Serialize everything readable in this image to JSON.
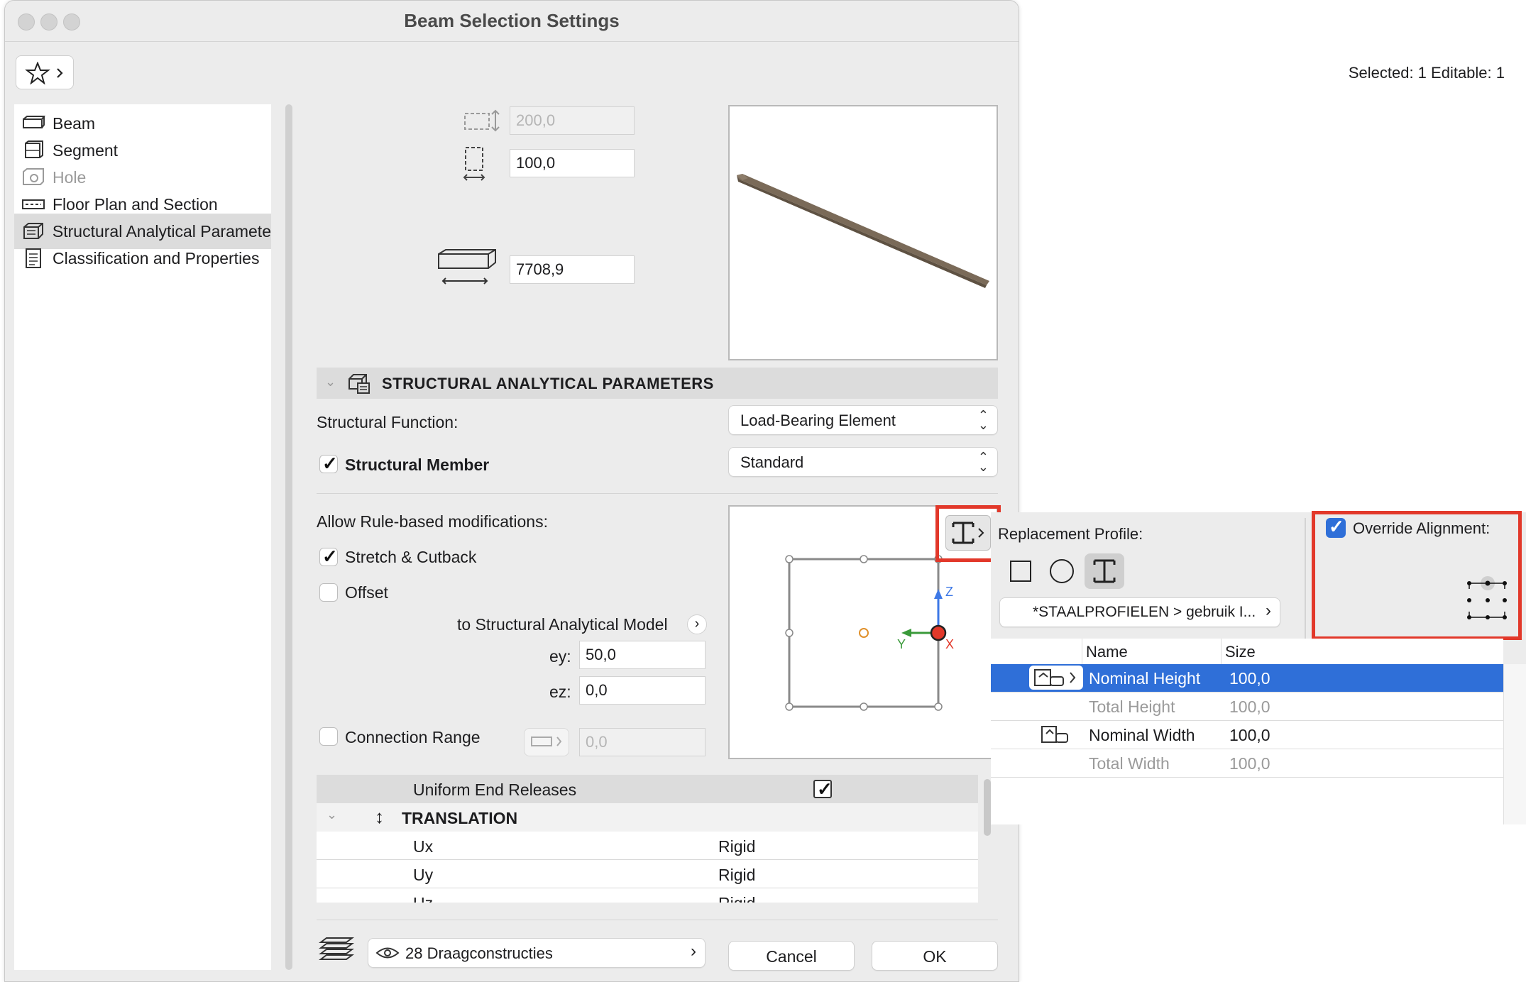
{
  "window": {
    "title": "Beam Selection Settings"
  },
  "header": {
    "selected_info": "Selected: 1 Editable: 1"
  },
  "sidebar": {
    "items": [
      {
        "label": "Beam",
        "icon": "beam-icon"
      },
      {
        "label": "Segment",
        "icon": "segment-icon"
      },
      {
        "label": "Hole",
        "icon": "hole-icon"
      },
      {
        "label": "Floor Plan and Section",
        "icon": "floor-plan-icon"
      },
      {
        "label": "Structural Analytical Paramete",
        "icon": "structural-analytical-icon"
      },
      {
        "label": "Classification and Properties",
        "icon": "classification-icon"
      }
    ],
    "selected_index": 4
  },
  "geometry": {
    "height_value": "200,0",
    "width_value": "100,0",
    "length_value": "7708,9"
  },
  "section": {
    "title": "STRUCTURAL ANALYTICAL PARAMETERS"
  },
  "structural": {
    "function_label": "Structural Function:",
    "function_value": "Load-Bearing Element",
    "member_label": "Structural Member",
    "member_checked": true,
    "member_value": "Standard",
    "rule_label": "Allow Rule-based modifications:",
    "stretch_label": "Stretch & Cutback",
    "stretch_checked": true,
    "offset_label": "Offset",
    "offset_checked": false,
    "to_model_label": "to Structural Analytical Model",
    "ey_label": "ey:",
    "ey_value": "50,0",
    "ez_label": "ez:",
    "ez_value": "0,0",
    "connection_label": "Connection Range",
    "connection_checked": false,
    "connection_value": "0,0"
  },
  "axes": {
    "z": "Z",
    "y": "Y",
    "x": "X"
  },
  "releases": {
    "uniform_label": "Uniform End Releases",
    "uniform_checked": true,
    "translation_label": "TRANSLATION",
    "rows": [
      {
        "name": "Ux",
        "value": "Rigid"
      },
      {
        "name": "Uy",
        "value": "Rigid"
      },
      {
        "name": "Uz",
        "value": "Rigid"
      }
    ]
  },
  "footer": {
    "layer_value": "28 Draagconstructies",
    "cancel_label": "Cancel",
    "ok_label": "OK"
  },
  "profile_panel": {
    "replacement_label": "Replacement Profile:",
    "override_label": "Override Alignment:",
    "override_checked": true,
    "profile_path": "*STAALPROFIELEN > gebruik I...",
    "col_name": "Name",
    "col_size": "Size",
    "rows": [
      {
        "name": "Nominal Height",
        "size": "100,0"
      },
      {
        "name": "Total Height",
        "size": "100,0"
      },
      {
        "name": "Nominal Width",
        "size": "100,0"
      },
      {
        "name": "Total Width",
        "size": "100,0"
      }
    ]
  },
  "colors": {
    "highlight": "#2f6fd8",
    "callout": "#e2382a",
    "beam": "#7a6a58"
  }
}
